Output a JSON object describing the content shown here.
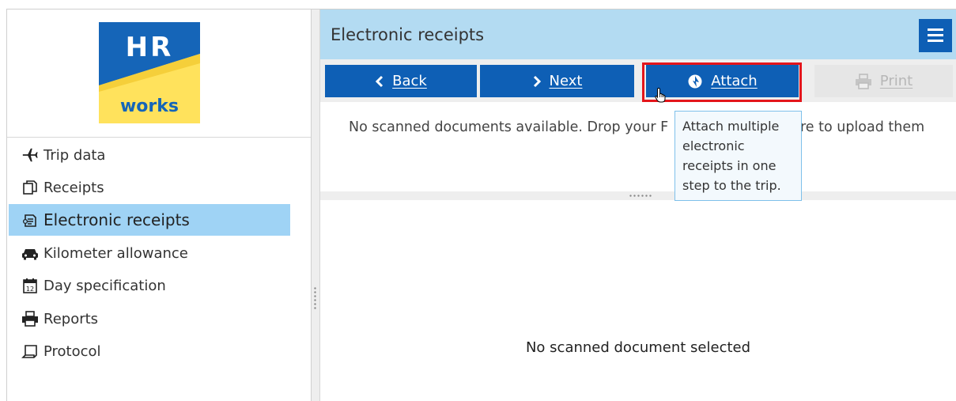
{
  "logo": {
    "line1": "HR",
    "line2": "works"
  },
  "sidebar": {
    "items": [
      {
        "label": "Trip data",
        "icon": "airplane-icon"
      },
      {
        "label": "Receipts",
        "icon": "receipts-icon"
      },
      {
        "label": "Electronic receipts",
        "icon": "electronic-receipt-icon"
      },
      {
        "label": "Kilometer allowance",
        "icon": "car-icon"
      },
      {
        "label": "Day specification",
        "icon": "calendar-icon"
      },
      {
        "label": "Reports",
        "icon": "printer-icon"
      },
      {
        "label": "Protocol",
        "icon": "protocol-icon"
      }
    ],
    "active_item": "Electronic receipts"
  },
  "header": {
    "title": "Electronic receipts",
    "menu_icon": "hamburger-icon"
  },
  "toolbar": {
    "back": {
      "label": "Back",
      "icon": "chevron-left-icon"
    },
    "next": {
      "label": "Next",
      "icon": "chevron-right-icon"
    },
    "attach": {
      "label": "Attach",
      "icon": "attach-icon"
    },
    "print": {
      "label": "Print",
      "icon": "printer-icon",
      "disabled": true
    }
  },
  "drop_area": {
    "text_before": "No scanned documents available. Drop your F",
    "text_after": "ere to upload them"
  },
  "tooltip": {
    "text": "Attach multiple electronic receipts in one step to the trip."
  },
  "viewer": {
    "empty_text": "No scanned document selected"
  },
  "colors": {
    "accent": "#0e5fb5",
    "header_bg": "#b3dbf2",
    "active_nav": "#9fd3f5",
    "highlight": "#e4151b",
    "logo_yellow": "#ffe25c"
  }
}
